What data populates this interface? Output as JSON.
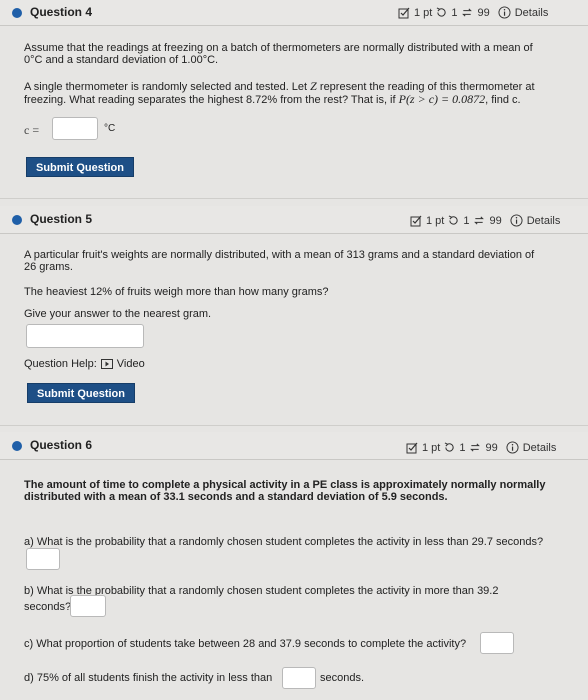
{
  "questions": [
    {
      "title": "Question 4",
      "pts": "1 pt",
      "attempts": "1",
      "tries": "99",
      "details": "Details",
      "p1_line1": "Assume that the readings at freezing on a batch of thermometers are normally distributed with a mean of",
      "p1_line2": "0°C and a standard deviation of 1.00°C.",
      "p2_line1a": "A single thermometer is randomly selected and tested. Let ",
      "p2_var": "Z",
      "p2_line1b": " represent the reading of this thermometer at",
      "p2_line2a": "freezing. What reading separates the highest 8.72% from the rest? That is, if ",
      "p2_math": "P(z > c) = 0.0872",
      "p2_line2b": ", find c.",
      "answer_label": "c =",
      "unit": "°C",
      "submit": "Submit Question"
    },
    {
      "title": "Question 5",
      "pts": "1 pt",
      "attempts": "1",
      "tries": "99",
      "details": "Details",
      "p1_line1": "A particular fruit's weights are normally distributed, with a mean of 313 grams and a standard deviation of",
      "p1_line2": "26 grams.",
      "p2": "The heaviest 12% of fruits weigh more than how many grams?",
      "p3": "Give your answer to the nearest gram.",
      "help_label": "Question Help:",
      "help_video": "Video",
      "submit": "Submit Question"
    },
    {
      "title": "Question 6",
      "pts": "1 pt",
      "attempts": "1",
      "tries": "99",
      "details": "Details",
      "p1_line1": "The amount of time to complete a physical activity in a PE class is approximately normally normally",
      "p1_line2": "distributed with a mean of 33.1 seconds and a standard deviation of 5.9 seconds.",
      "a": "a) What is the probability that a randomly chosen student completes the activity in less than 29.7 seconds?",
      "b_line1": "b) What is the probability that a randomly chosen student completes the activity in more than 39.2",
      "b_line2": "seconds?",
      "c": "c) What proportion of students take between 28 and 37.9 seconds to complete the activity?",
      "d_a": "d) 75% of all students finish the activity in less than",
      "d_b": "seconds."
    }
  ]
}
